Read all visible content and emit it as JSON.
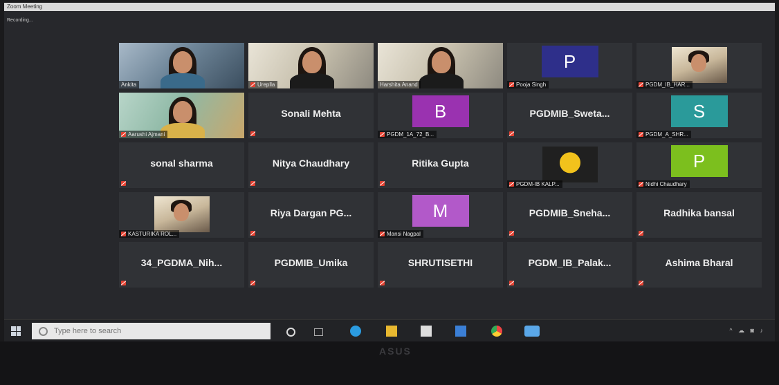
{
  "window": {
    "title": "Zoom Meeting",
    "recording": "Recording..."
  },
  "participants": [
    {
      "name": "Ankita",
      "kind": "video",
      "muted": false
    },
    {
      "name": "Ureplla",
      "kind": "video",
      "muted": true
    },
    {
      "name": "Harshita Anand",
      "kind": "video",
      "muted": false,
      "active": true
    },
    {
      "name": "Pooja Singh",
      "kind": "avatar",
      "letter": "P",
      "color": "#2e2f8a",
      "muted": true
    },
    {
      "name": "PGDM_IB_HAR...",
      "kind": "thumb",
      "muted": true
    },
    {
      "name": "Aarushi Ajmani",
      "kind": "video",
      "muted": true
    },
    {
      "name": "Sonali Mehta",
      "kind": "name",
      "muted": true
    },
    {
      "name": "PGDM_1A_72_B...",
      "kind": "avatar",
      "letter": "B",
      "color": "#9a32b0",
      "muted": true
    },
    {
      "name": "PGDMIB_Sweta...",
      "kind": "name",
      "muted": true
    },
    {
      "name": "PGDM_A_SHR...",
      "kind": "avatar",
      "letter": "S",
      "color": "#2a9a9a",
      "muted": true
    },
    {
      "name": "sonal sharma",
      "kind": "name",
      "muted": true
    },
    {
      "name": "Nitya Chaudhary",
      "kind": "name",
      "muted": true
    },
    {
      "name": "Ritika Gupta",
      "kind": "name",
      "muted": true
    },
    {
      "name": "PGDM-IB KALP...",
      "kind": "thumb-yellow",
      "muted": true
    },
    {
      "name": "Nidhi Chaudhary",
      "kind": "avatar",
      "letter": "P",
      "color": "#7cbf1e",
      "muted": true
    },
    {
      "name": "KASTURIKA ROL...",
      "kind": "thumb",
      "muted": true
    },
    {
      "name": "Riya Dargan PG...",
      "kind": "name",
      "muted": true
    },
    {
      "name": "Mansi Nagpal",
      "kind": "avatar",
      "letter": "M",
      "color": "#b259c9",
      "muted": true
    },
    {
      "name": "PGDMIB_Sneha...",
      "kind": "name",
      "muted": true
    },
    {
      "name": "Radhika bansal",
      "kind": "name",
      "muted": true
    },
    {
      "name": "34_PGDMA_Nih...",
      "kind": "name",
      "muted": true
    },
    {
      "name": "PGDMIB_Umika",
      "kind": "name",
      "muted": true
    },
    {
      "name": "SHRUTISETHI",
      "kind": "name",
      "muted": true
    },
    {
      "name": "PGDM_IB_Palak...",
      "kind": "name",
      "muted": true
    },
    {
      "name": "Ashima Bharal",
      "kind": "name",
      "muted": true
    }
  ],
  "taskbar": {
    "search_placeholder": "Type here to search",
    "icons": [
      "cortana-icon",
      "task-view-icon",
      "edge-icon",
      "file-explorer-icon",
      "store-icon",
      "mail-icon",
      "chrome-icon",
      "zoom-icon"
    ],
    "tray": "^ ☁ ◙ ♪"
  },
  "laptop": {
    "brand": "ASUS"
  }
}
